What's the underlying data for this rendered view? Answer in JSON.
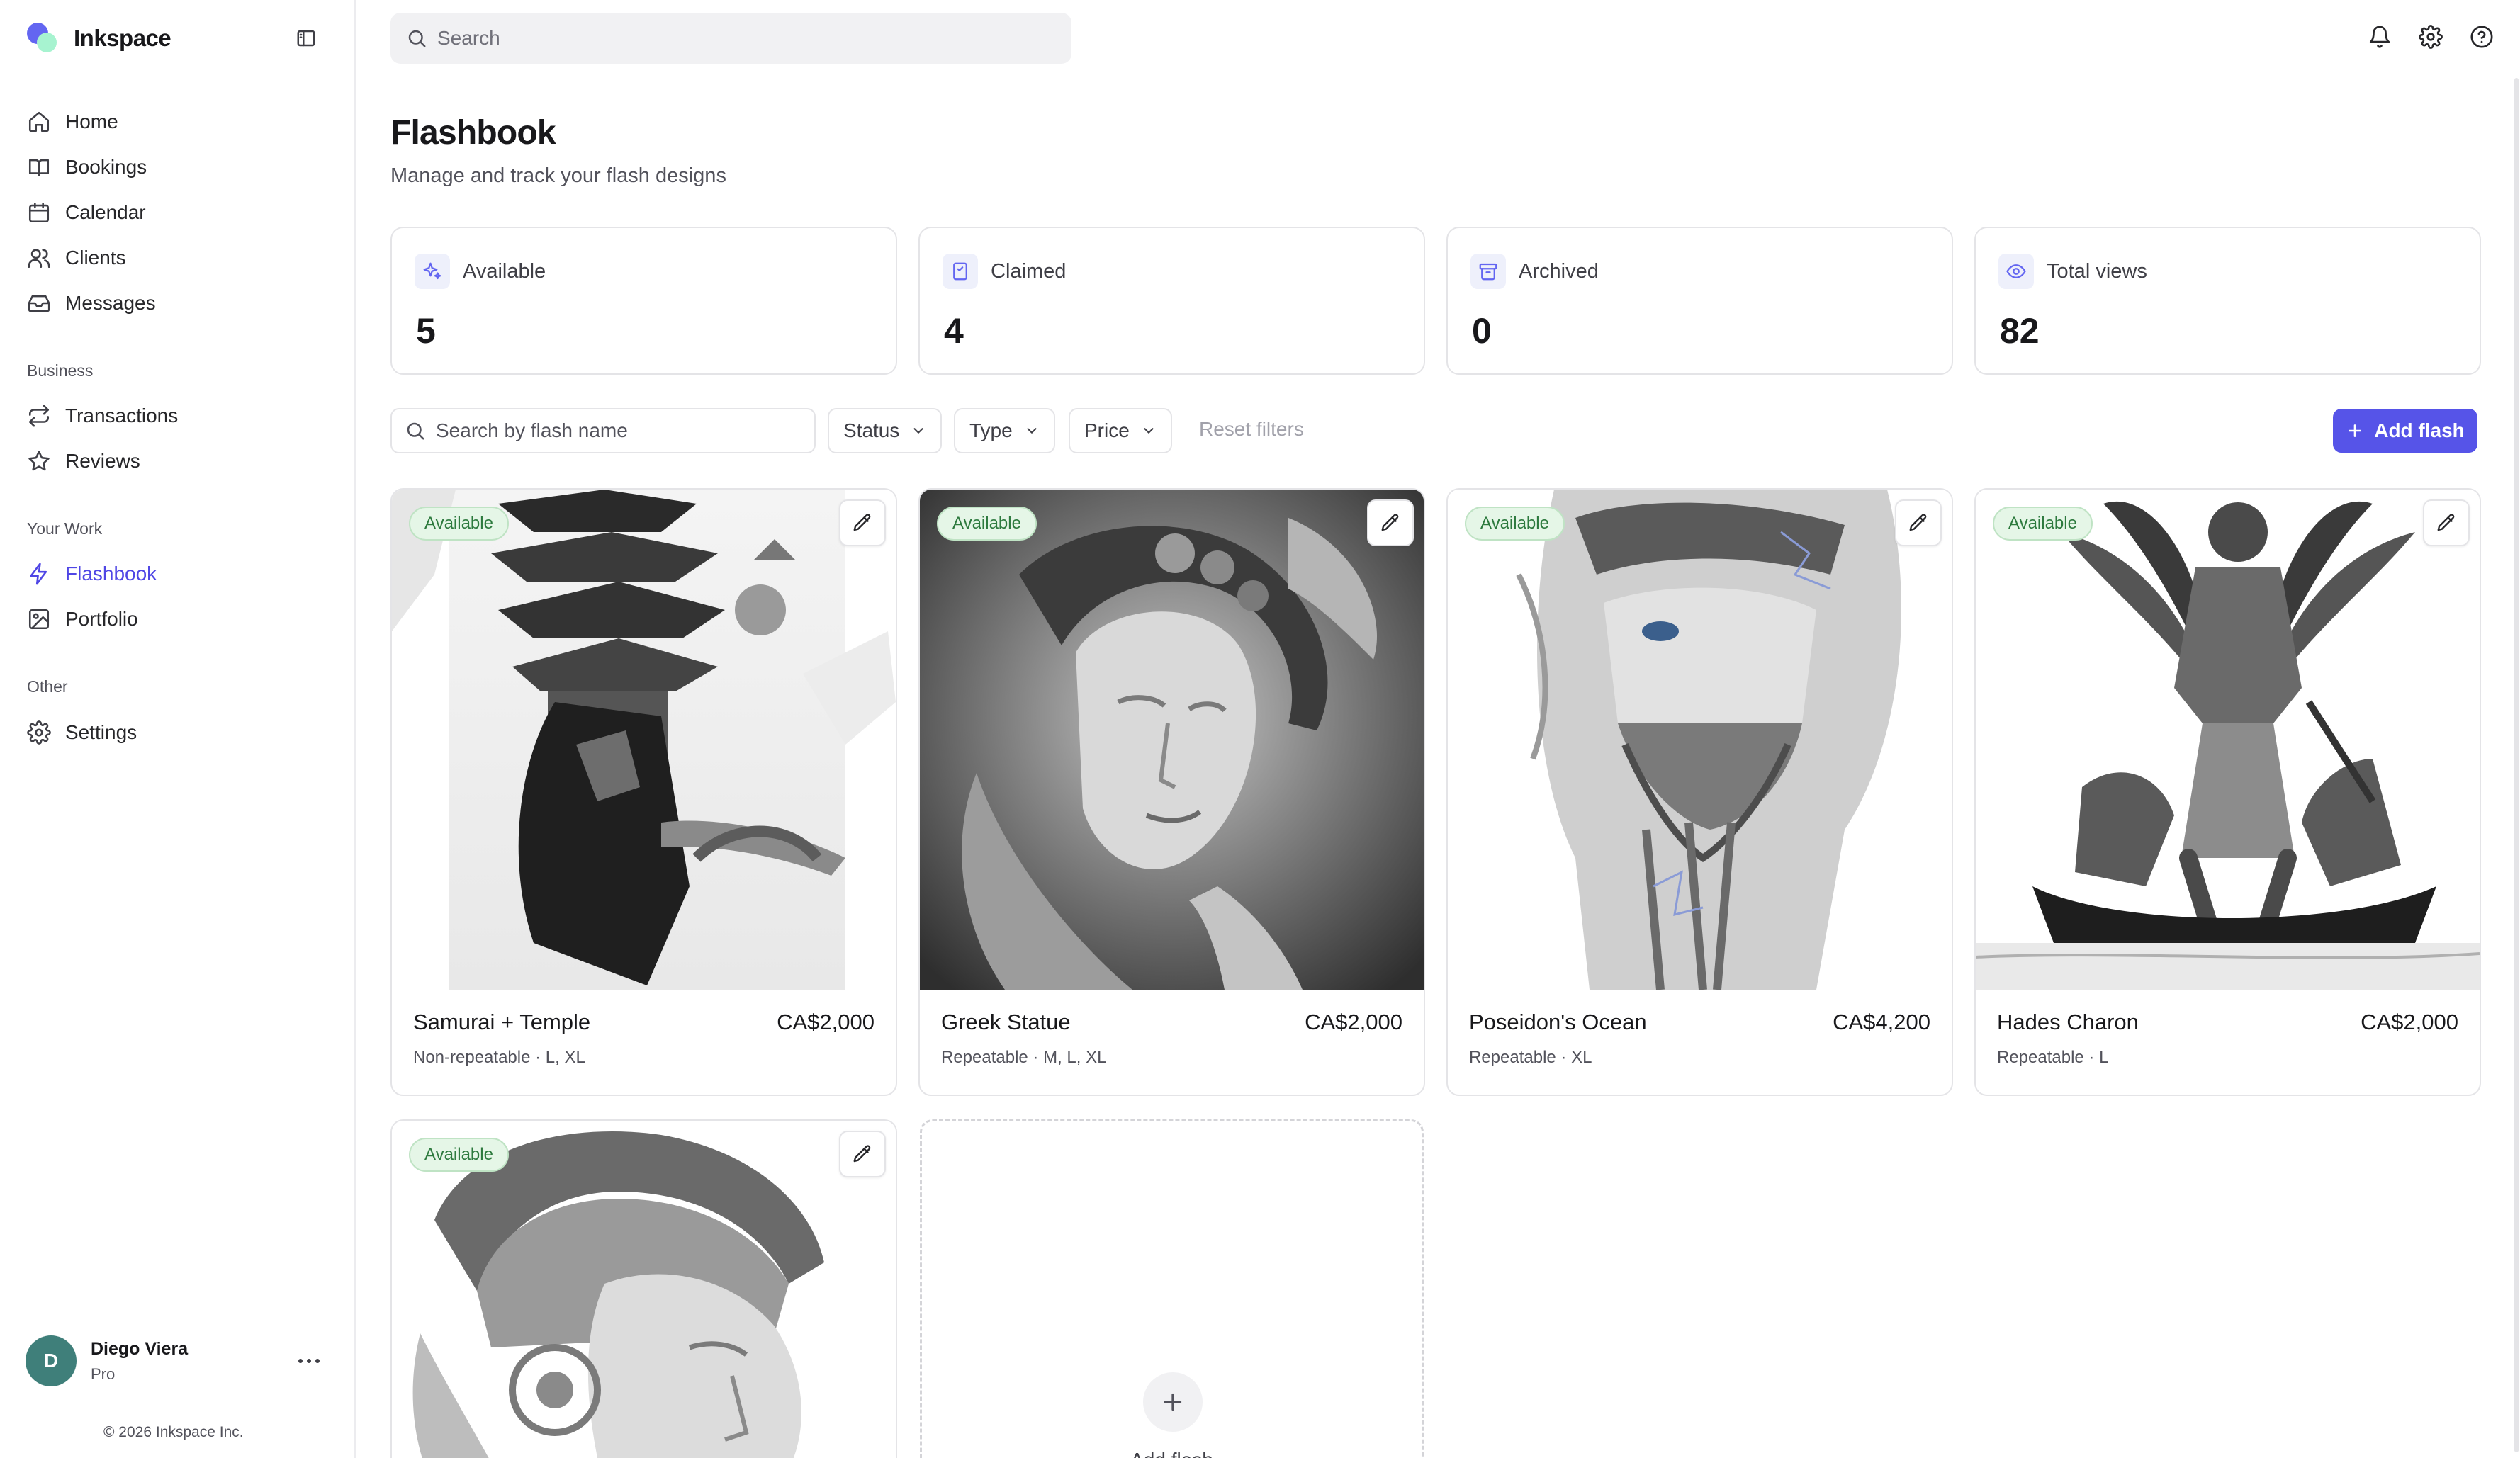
{
  "app": {
    "name": "Inkspace"
  },
  "nav": {
    "main": [
      {
        "label": "Home",
        "icon": "home-icon"
      },
      {
        "label": "Bookings",
        "icon": "book-open-icon"
      },
      {
        "label": "Calendar",
        "icon": "calendar-icon"
      },
      {
        "label": "Clients",
        "icon": "users-icon"
      },
      {
        "label": "Messages",
        "icon": "inbox-icon"
      }
    ],
    "business_heading": "Business",
    "business": [
      {
        "label": "Transactions",
        "icon": "transfer-arrows-icon"
      },
      {
        "label": "Reviews",
        "icon": "star-icon"
      }
    ],
    "work_heading": "Your Work",
    "work": [
      {
        "label": "Flashbook",
        "icon": "zap-icon",
        "active": true
      },
      {
        "label": "Portfolio",
        "icon": "image-icon"
      }
    ],
    "other_heading": "Other",
    "other": [
      {
        "label": "Settings",
        "icon": "gear-icon"
      }
    ]
  },
  "user": {
    "initial": "D",
    "name": "Diego Viera",
    "plan": "Pro"
  },
  "footer": {
    "copyright": "© 2026 Inkspace Inc."
  },
  "topbar": {
    "search_placeholder": "Search"
  },
  "page": {
    "title": "Flashbook",
    "subtitle": "Manage and track your flash designs"
  },
  "stats": [
    {
      "label": "Available",
      "value": "5",
      "icon": "sparkles-icon"
    },
    {
      "label": "Claimed",
      "value": "4",
      "icon": "bookmark-icon"
    },
    {
      "label": "Archived",
      "value": "0",
      "icon": "archive-icon"
    },
    {
      "label": "Total views",
      "value": "82",
      "icon": "eye-icon"
    }
  ],
  "filters": {
    "search_placeholder": "Search by flash name",
    "status": "Status",
    "type": "Type",
    "price": "Price",
    "reset": "Reset filters",
    "add_button": "Add flash"
  },
  "flashes": [
    {
      "status": "Available",
      "name": "Samurai + Temple",
      "price": "CA$2,000",
      "meta": "Non-repeatable · L, XL"
    },
    {
      "status": "Available",
      "name": "Greek Statue",
      "price": "CA$2,000",
      "meta": "Repeatable · M, L, XL"
    },
    {
      "status": "Available",
      "name": "Poseidon's Ocean",
      "price": "CA$4,200",
      "meta": "Repeatable · XL"
    },
    {
      "status": "Available",
      "name": "Hades Charon",
      "price": "CA$2,000",
      "meta": "Repeatable · L"
    },
    {
      "status": "Available",
      "name": "",
      "price": "",
      "meta": ""
    }
  ],
  "add_card": {
    "label": "Add flash"
  },
  "colors": {
    "accent": "#5654e8",
    "available_badge_bg": "#e5f6e7",
    "available_badge_text": "#2d7a3e"
  }
}
